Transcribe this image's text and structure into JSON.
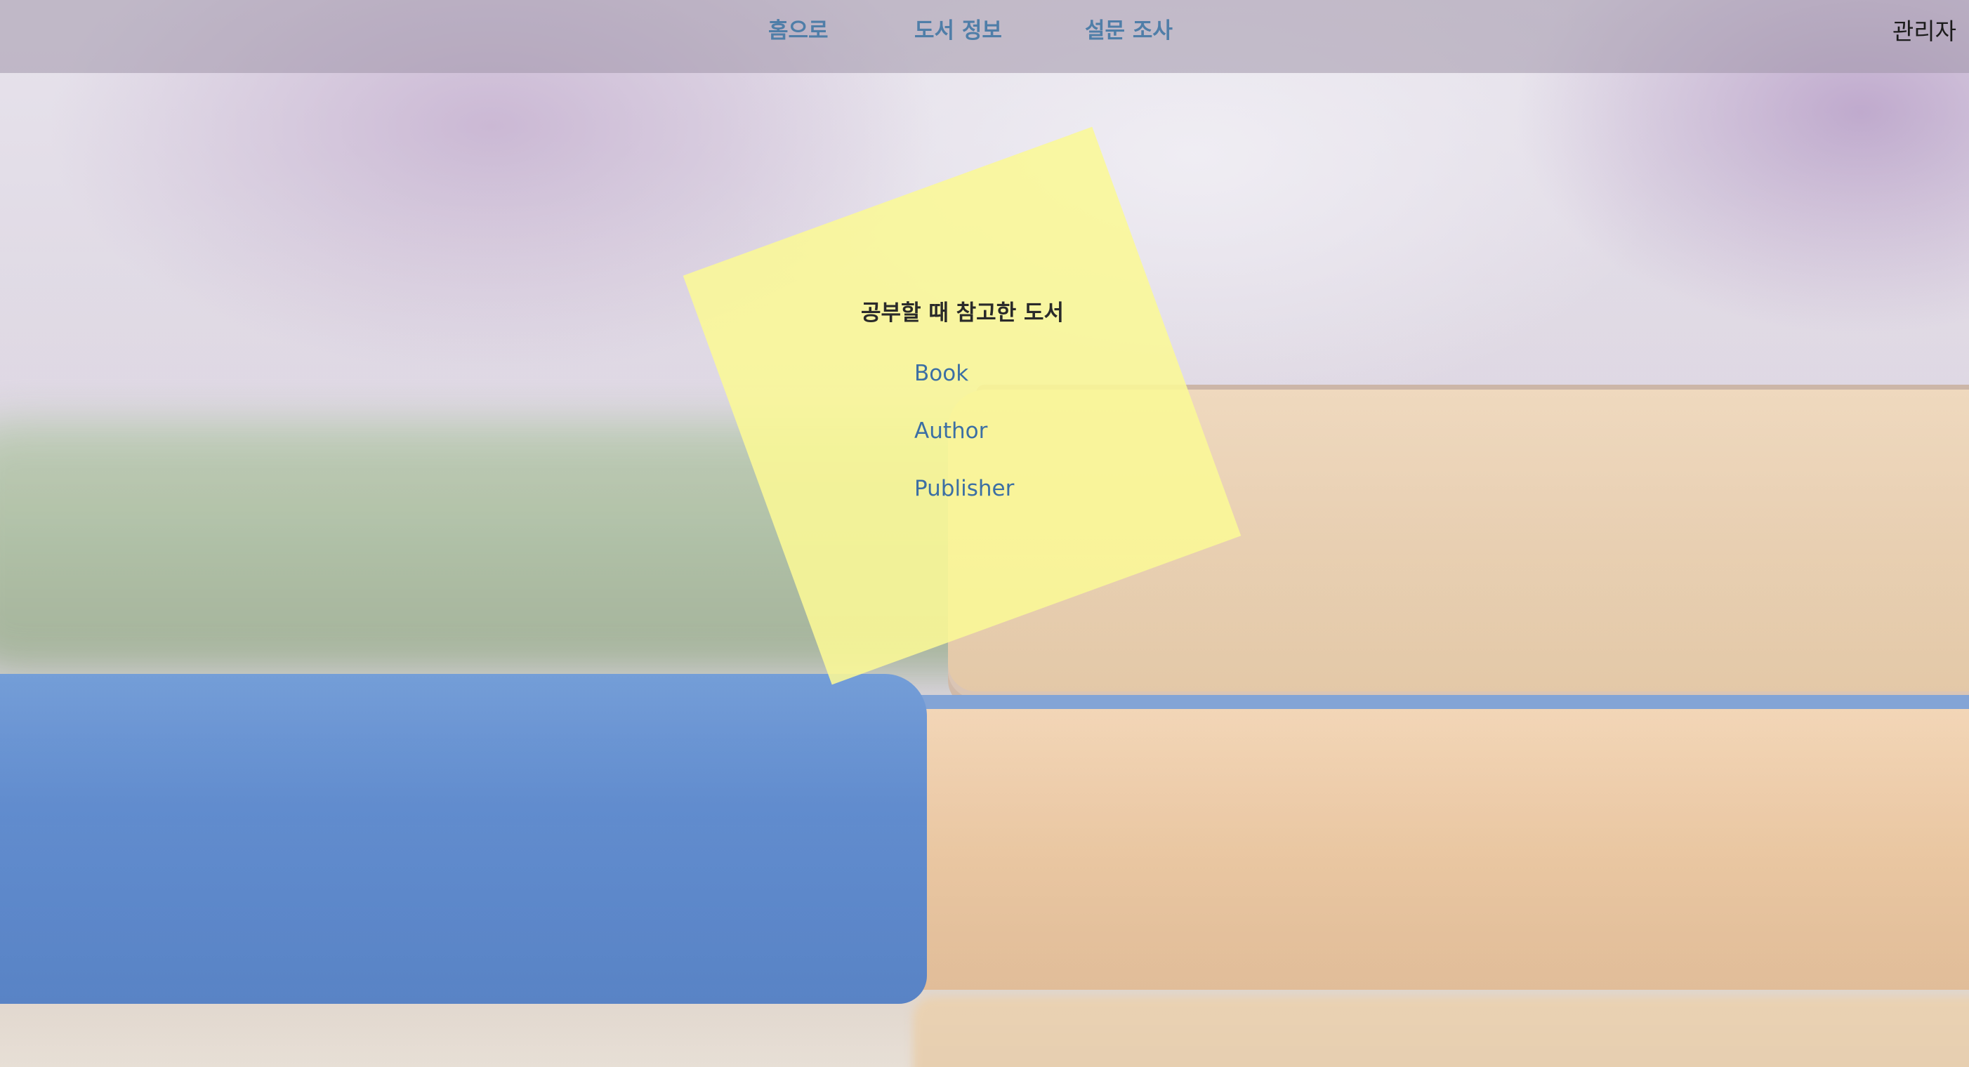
{
  "nav": {
    "home_label": "홈으로",
    "books_label": "도서 정보",
    "survey_label": "설문 조사",
    "admin_label": "관리자"
  },
  "note": {
    "title": "공부할 때 참고한 도서",
    "links": [
      {
        "label": "Book"
      },
      {
        "label": "Author"
      },
      {
        "label": "Publisher"
      }
    ]
  },
  "colors": {
    "nav_link": "#4f7ea8",
    "note_link": "#3c6fa4",
    "note_background": "#f8f696"
  }
}
